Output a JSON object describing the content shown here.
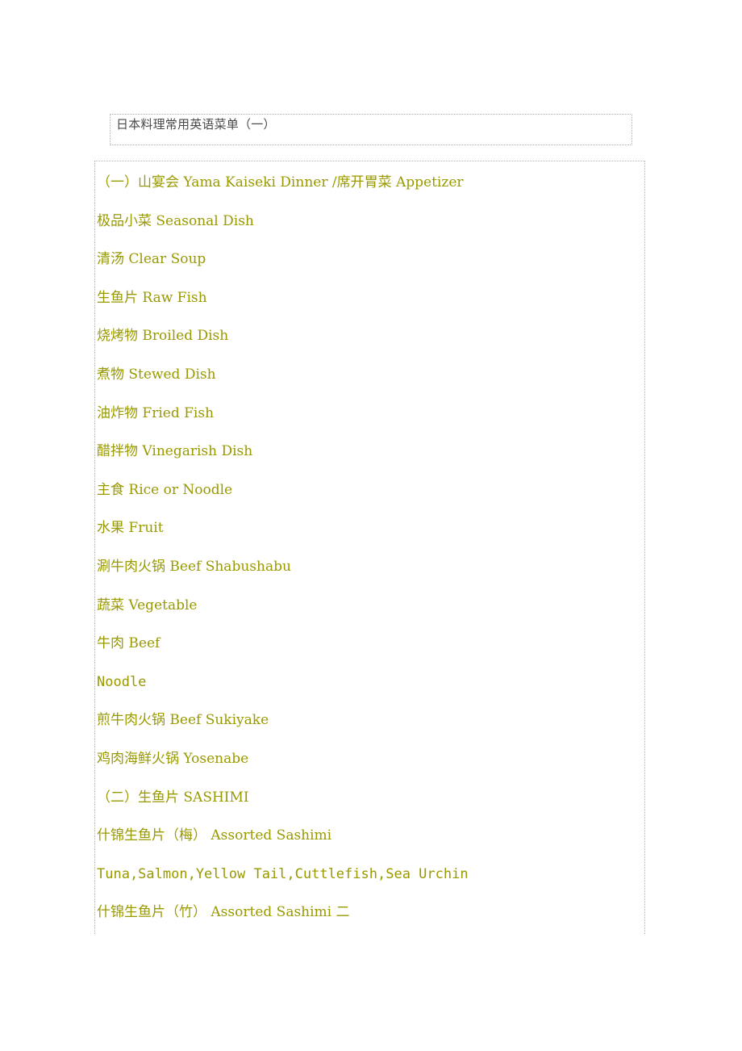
{
  "document": {
    "title_box": {
      "title": "日本料理常用英语菜单（一）"
    },
    "menu": {
      "lines": [
        {
          "text": "（一）山宴会 Yama Kaiseki Dinner /席开胃菜 Appetizer"
        },
        {
          "text": "极品小菜 Seasonal Dish"
        },
        {
          "text": "清汤 Clear Soup"
        },
        {
          "text": "生鱼片 Raw Fish"
        },
        {
          "text": "烧烤物 Broiled Dish"
        },
        {
          "text": "煮物 Stewed Dish"
        },
        {
          "text": "油炸物 Fried Fish"
        },
        {
          "text": "醋拌物 Vinegarish Dish"
        },
        {
          "text": "主食 Rice or Noodle"
        },
        {
          "text": "水果 Fruit"
        },
        {
          "text": "涮牛肉火锅 Beef Shabushabu"
        },
        {
          "text": "蔬菜 Vegetable"
        },
        {
          "text": "牛肉 Beef"
        },
        {
          "text": "Noodle"
        },
        {
          "text": "煎牛肉火锅 Beef Sukiyake"
        },
        {
          "text": "鸡肉海鲜火锅 Yosenabe"
        },
        {
          "text": "（二）生鱼片 SASHIMI"
        },
        {
          "text": "什锦生鱼片（梅） Assorted Sashimi"
        },
        {
          "text": "Tuna,Salmon,Yellow Tail,Cuttlefish,Sea Urchin"
        },
        {
          "text": "什锦生鱼片（竹） Assorted Sashimi 二"
        }
      ]
    }
  },
  "colors": {
    "text_olive": "#999900",
    "title_gray": "#4a4a4a",
    "border_gray": "#b5b5b5",
    "page_background": "#ffffff"
  }
}
